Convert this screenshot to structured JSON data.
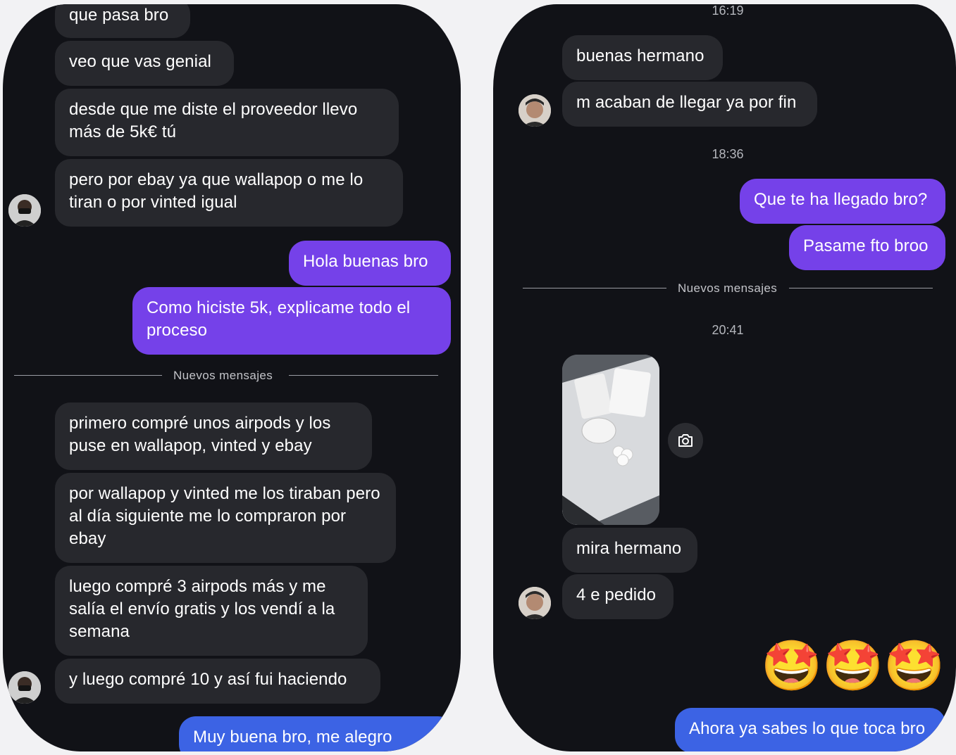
{
  "left": {
    "messages": [
      "que pasa bro",
      "veo que vas genial",
      "desde que me diste el proveedor llevo más de 5k€ tú",
      "pero por ebay ya que wallapop o me lo tiran o por vinted igual",
      "Hola buenas bro",
      "Como hiciste 5k, explicame todo el proceso",
      "primero compré unos airpods y los puse en wallapop, vinted y ebay",
      "por wallapop y vinted me los tiraban pero al día siguiente me lo compraron por ebay",
      "luego compré 3 airpods más y me salía el envío gratis y los vendí a la semana",
      "y luego compré 10 y así fui haciendo",
      "Muy buena bro, me alegro"
    ],
    "separator": "Nuevos mensajes"
  },
  "right": {
    "times": [
      "16:19",
      "18:36",
      "20:41"
    ],
    "messages": [
      "buenas hermano",
      "m acaban de llegar ya por fin",
      "Que te ha llegado bro?",
      "Pasame fto broo",
      "mira hermano",
      "4 e pedido",
      "Ahora ya sabes lo que toca bro"
    ],
    "separator": "Nuevos mensajes",
    "emoji_reaction": "🤩🤩🤩",
    "icons": [
      "camera-icon"
    ]
  },
  "colors": {
    "background": "#111217",
    "incoming_bubble": "#27282d",
    "outgoing_purple": "#7541e9",
    "outgoing_blue": "#3c63e4"
  }
}
